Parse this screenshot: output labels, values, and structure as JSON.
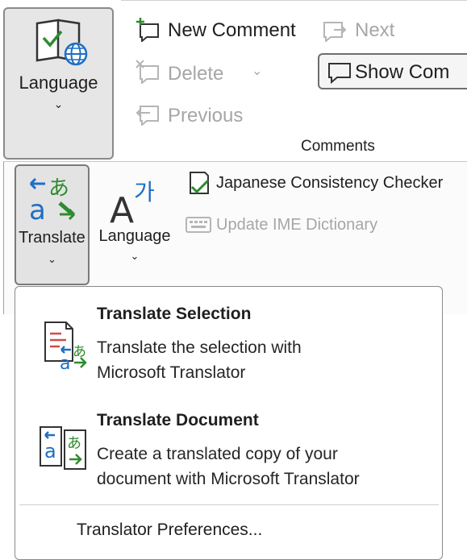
{
  "ribbon": {
    "language_big": {
      "label": "Language",
      "icon": "language-globe-icon"
    },
    "review": {
      "new_comment": "New Comment",
      "delete": "Delete",
      "previous": "Previous",
      "next": "Next",
      "show_comments": "Show Com",
      "group_label": "Comments"
    },
    "language_group": {
      "translate": "Translate",
      "language": "Language",
      "japanese_consistency": "Japanese Consistency Checker",
      "update_ime": "Update IME Dictionary"
    }
  },
  "dropdown": {
    "items": [
      {
        "title": "Translate Selection",
        "desc1": "Translate the selection with",
        "desc2": "Microsoft Translator"
      },
      {
        "title": "Translate Document",
        "desc1": "Create a translated copy of your",
        "desc2": "document with Microsoft Translator"
      }
    ],
    "preferences": "Translator Preferences..."
  },
  "colors": {
    "accent_blue": "#1e6fc4",
    "accent_green": "#2e8b2e",
    "disabled": "#a6a6a6"
  }
}
